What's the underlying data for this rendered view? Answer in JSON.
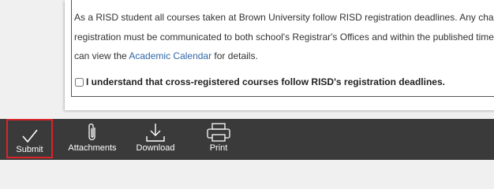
{
  "notice": {
    "line1": "As a RISD student all courses taken at Brown University follow RISD registration deadlines. Any change",
    "line2": "registration must be communicated to both school's Registrar's Offices and within the published timel",
    "line3_pre": "can view the ",
    "line3_link": "Academic Calendar",
    "line3_post": " for details."
  },
  "acknowledgement": {
    "label": "I understand that cross-registered courses follow RISD's registration deadlines.",
    "checked": false
  },
  "toolbar": {
    "submit": "Submit",
    "attachments": "Attachments",
    "download": "Download",
    "print": "Print"
  },
  "colors": {
    "toolbar_bg": "#3a3a3a",
    "highlight": "#d9242b",
    "link": "#2f67a8"
  }
}
